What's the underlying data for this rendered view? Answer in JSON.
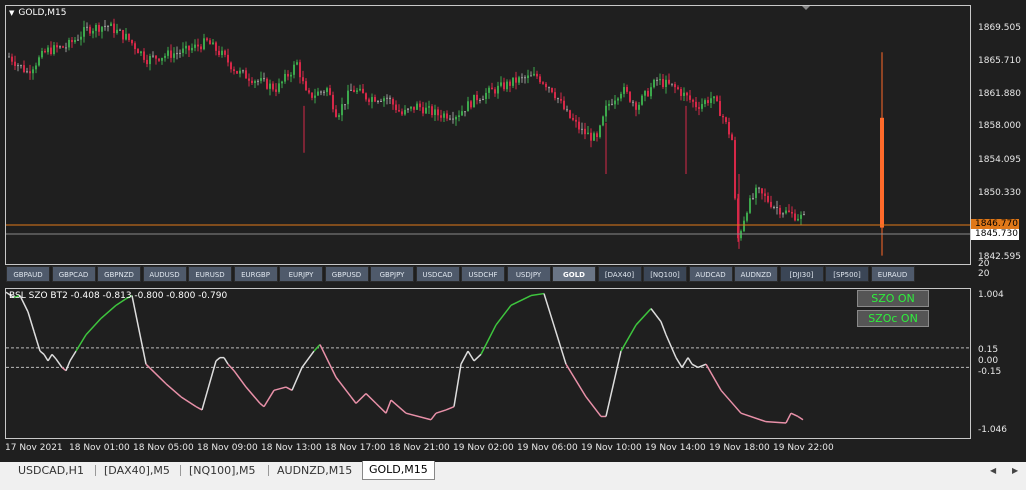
{
  "chart": {
    "title": "GOLD,M15",
    "price_ticks": [
      "1869.505",
      "1865.710",
      "1861.880",
      "1858.000",
      "1854.095",
      "1850.330",
      "1842.595"
    ],
    "bid_tag": "1846.770",
    "ask_tag": "1845.730",
    "sub_ticks": [
      "1.004",
      "0.15",
      "0.00",
      "-0.15",
      "-1.046"
    ],
    "extra_ticks": [
      "20",
      "20"
    ],
    "colors": {
      "bull": "#3ca84c",
      "bear": "#d62848",
      "neutral": "#9a9a9a",
      "bid_line": "#e07818",
      "osc_up": "#3ec53e",
      "osc_mid": "#dddddd",
      "osc_down": "#e890a8",
      "spike": "#ff6a2a"
    }
  },
  "symbols": [
    "GBPAUD",
    "GBPCAD",
    "GBPNZD",
    "AUDUSD",
    "EURUSD",
    "EURGBP",
    "EURJPY",
    "GBPUSD",
    "GBPJPY",
    "USDCAD",
    "USDCHF",
    "USDJPY",
    "GOLD",
    "[DAX40]",
    "[NQ100]",
    "AUDCAD",
    "AUDNZD",
    "[DJI30]",
    "[SP500]",
    "EURAUD"
  ],
  "active_symbol": "GOLD",
  "indicator": {
    "title": "BSL SZO BT2 -0.408 -0.813 -0.800 -0.800 -0.790",
    "btn_szo": "SZO ON",
    "btn_szoc": "SZOc ON"
  },
  "time_labels": [
    "17 Nov 2021",
    "18 Nov 01:00",
    "18 Nov 05:00",
    "18 Nov 09:00",
    "18 Nov 13:00",
    "18 Nov 17:00",
    "18 Nov 21:00",
    "19 Nov 02:00",
    "19 Nov 06:00",
    "19 Nov 10:00",
    "19 Nov 14:00",
    "19 Nov 18:00",
    "19 Nov 22:00"
  ],
  "tabs": [
    "USDCAD,H1",
    "[DAX40],M5",
    "[NQ100],M5",
    "AUDNZD,M15",
    "GOLD,M15"
  ],
  "active_tab": "GOLD,M15",
  "icons": {
    "tab_left": "triangle-left-icon",
    "tab_right": "triangle-right-icon",
    "title_menu": "triangle-down-icon"
  }
}
